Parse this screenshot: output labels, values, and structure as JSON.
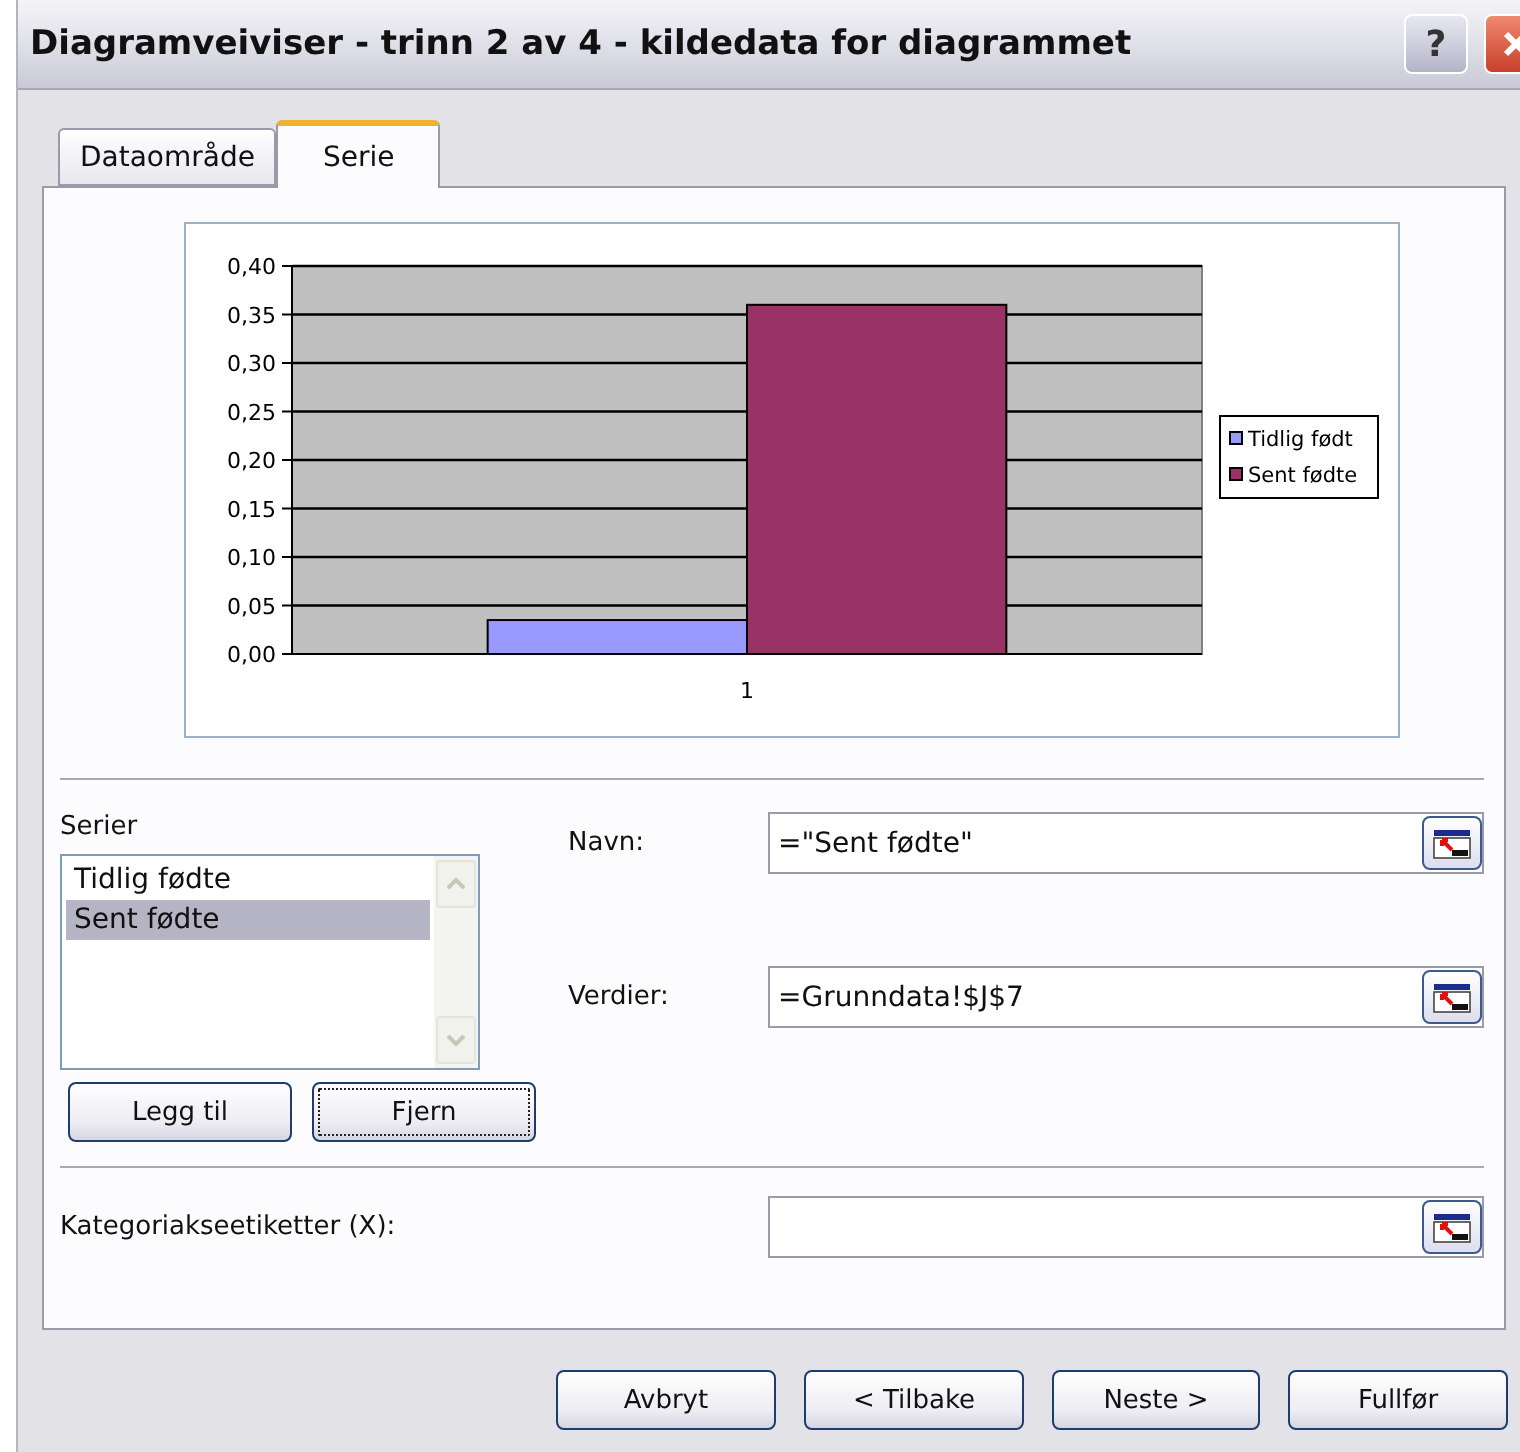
{
  "window": {
    "title": "Diagramveiviser - trinn 2 av 4 - kildedata for diagrammet",
    "help_button": "?"
  },
  "tabs": [
    {
      "label": "Dataområde",
      "selected": false
    },
    {
      "label": "Serie",
      "selected": true
    }
  ],
  "chart": {
    "chart_data": {
      "type": "bar",
      "categories": [
        "1"
      ],
      "series": [
        {
          "name": "Tidlig født",
          "color": "#9999ff",
          "values": [
            0.035
          ]
        },
        {
          "name": "Sent fødte",
          "color": "#993366",
          "values": [
            0.36
          ]
        }
      ],
      "ylim": [
        0,
        0.4
      ],
      "grid": true,
      "legend": true,
      "yticks": [
        {
          "value": 0,
          "label": "0,00"
        },
        {
          "value": 0.05,
          "label": "0,05"
        },
        {
          "value": 0.1,
          "label": "0,10"
        },
        {
          "value": 0.15,
          "label": "0,15"
        },
        {
          "value": 0.2,
          "label": "0,20"
        },
        {
          "value": 0.25,
          "label": "0,25"
        },
        {
          "value": 0.3,
          "label": "0,30"
        },
        {
          "value": 0.35,
          "label": "0,35"
        },
        {
          "value": 0.4,
          "label": "0,40"
        }
      ]
    }
  },
  "series_list": {
    "label": "Serier",
    "items": [
      {
        "label": "Tidlig fødte",
        "selected": false
      },
      {
        "label": "Sent fødte",
        "selected": true
      }
    ]
  },
  "series_buttons": [
    {
      "label": "Legg til",
      "focused": false
    },
    {
      "label": "Fjern",
      "focused": true
    }
  ],
  "fields": [
    {
      "label": "Navn:",
      "value": "=\"Sent fødte\""
    },
    {
      "label": "Verdier:",
      "value": "=Grunndata!$J$7"
    }
  ],
  "category_field": {
    "label": "Kategoriakseetiketter (X):"
  },
  "buttons": [
    {
      "label": "Avbryt"
    },
    {
      "label": "< Tilbake"
    },
    {
      "label": "Neste >"
    },
    {
      "label": "Fullfør"
    }
  ]
}
